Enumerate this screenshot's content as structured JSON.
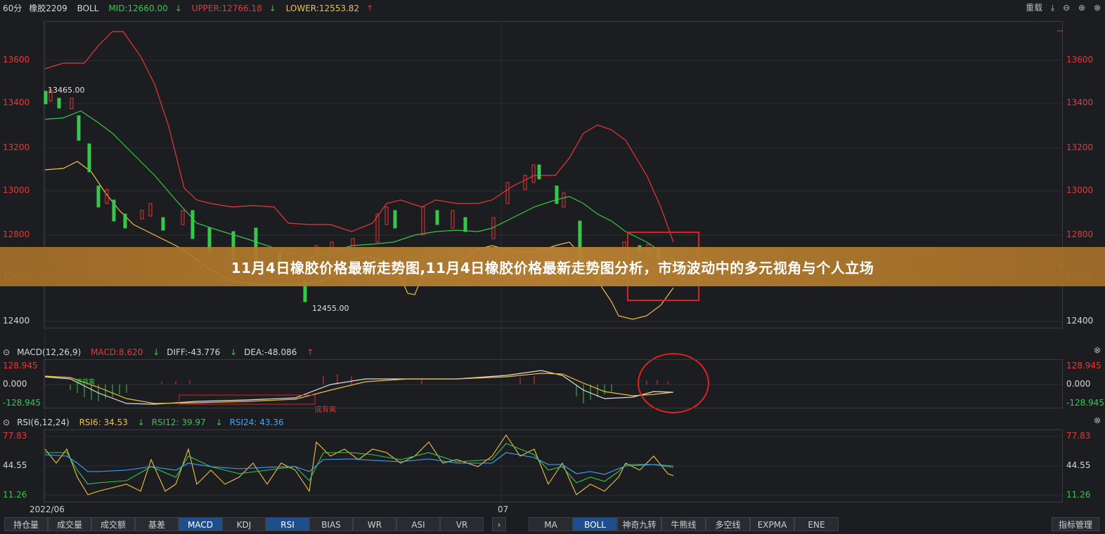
{
  "main_header": {
    "period": "60分",
    "symbol": "橡胶2209",
    "indicator": "BOLL",
    "mid": "MID:12660.00",
    "upper": "UPPER:12766.18",
    "lower": "LOWER:12553.82"
  },
  "window_controls": {
    "reset": "重载",
    "icons": [
      "download-icon",
      "zoom-out-icon",
      "zoom-in-icon",
      "close-icon"
    ]
  },
  "main_axis": {
    "ticks": [
      "13600",
      "13400",
      "13200",
      "13000",
      "12800",
      "12600",
      "12400"
    ]
  },
  "annotations": {
    "high": "13465.00",
    "low": "12455.00",
    "macd_bottom": "底背离",
    "macd_top": "底背离"
  },
  "banner": {
    "title": "11月4日橡胶价格最新走势图,11月4日橡胶价格最新走势图分析，市场波动中的多元视角与个人立场"
  },
  "macd_header": {
    "name": "MACD(12,26,9)",
    "macd": "MACD:8.620",
    "diff": "DIFF:-43.776",
    "dea": "DEA:-48.086"
  },
  "macd_axis": {
    "ticks": [
      "128.945",
      "0.000",
      "-128.945"
    ]
  },
  "rsi_header": {
    "name": "RSI(6,12,24)",
    "rsi6": "RSI6: 34.53",
    "rsi12": "RSI12: 39.97",
    "rsi24": "RSI24: 43.36"
  },
  "rsi_axis": {
    "ticks": [
      "77.83",
      "44.55",
      "11.26"
    ]
  },
  "dates": {
    "d1": "2022/06",
    "d2": "07"
  },
  "tabs_left": [
    {
      "label": "持仓量",
      "active": false
    },
    {
      "label": "成交量",
      "active": false
    },
    {
      "label": "成交额",
      "active": false
    },
    {
      "label": "基差",
      "active": false
    },
    {
      "label": "MACD",
      "active": true
    },
    {
      "label": "KDJ",
      "active": false
    },
    {
      "label": "RSI",
      "active": true
    },
    {
      "label": "BIAS",
      "active": false
    },
    {
      "label": "WR",
      "active": false
    },
    {
      "label": "ASI",
      "active": false
    },
    {
      "label": "VR",
      "active": false
    }
  ],
  "tabs_right": [
    {
      "label": "MA",
      "active": false
    },
    {
      "label": "BOLL",
      "active": true
    },
    {
      "label": "神奇九转",
      "active": false
    },
    {
      "label": "牛熊线",
      "active": false
    },
    {
      "label": "多空线",
      "active": false
    },
    {
      "label": "EXPMA",
      "active": false
    },
    {
      "label": "ENE",
      "active": false
    }
  ],
  "indicator_button": "指标管理",
  "colors": {
    "up": "#e6383a",
    "down": "#35c84a",
    "mid": "#35c84a",
    "upper": "#e6383a",
    "lower": "#f0c040",
    "rsi6": "#f0c040",
    "rsi12": "#35c84a",
    "rsi24": "#3fa7ff"
  }
}
